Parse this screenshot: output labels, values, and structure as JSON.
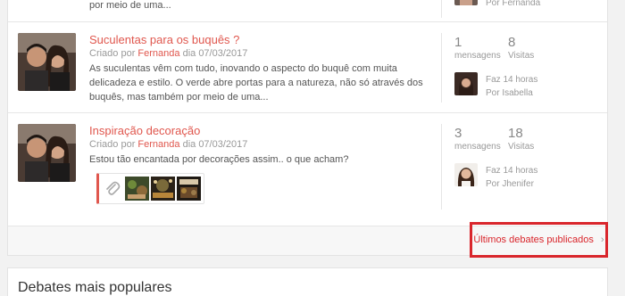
{
  "top_row": {
    "excerpt_tail": "por meio de uma...",
    "last_by": "Por Fernanda"
  },
  "topics": [
    {
      "title": "Suculentas para os buquês ?",
      "meta_prefix": "Criado por",
      "author": "Fernanda",
      "meta_suffix": "dia 07/03/2017",
      "excerpt": "As suculentas vêm com tudo, inovando o aspecto do buquê com muita delicadeza e estilo. O verde abre portas para a natureza, não só através dos buquês, mas também por meio de uma...",
      "messages": "1",
      "messages_label": "mensagens",
      "visits": "8",
      "visits_label": "Visitas",
      "last_time": "Faz 14 horas",
      "last_by": "Por Isabella"
    },
    {
      "title": "Inspiração decoração",
      "meta_prefix": "Criado por",
      "author": "Fernanda",
      "meta_suffix": "dia 07/03/2017",
      "excerpt": "Estou tão encantada por decorações assim.. o que acham?",
      "messages": "3",
      "messages_label": "mensagens",
      "visits": "18",
      "visits_label": "Visitas",
      "last_time": "Faz 14 horas",
      "last_by": "Por Jhenifer"
    }
  ],
  "footer": {
    "more_label": "Últimos debates publicados",
    "chevron": "›"
  },
  "popular": {
    "title": "Debates mais populares"
  },
  "colors": {
    "accent": "#e0574e",
    "highlight_border": "#d9262c"
  },
  "icons": [
    "paperclip-icon",
    "chevron-right-icon"
  ]
}
